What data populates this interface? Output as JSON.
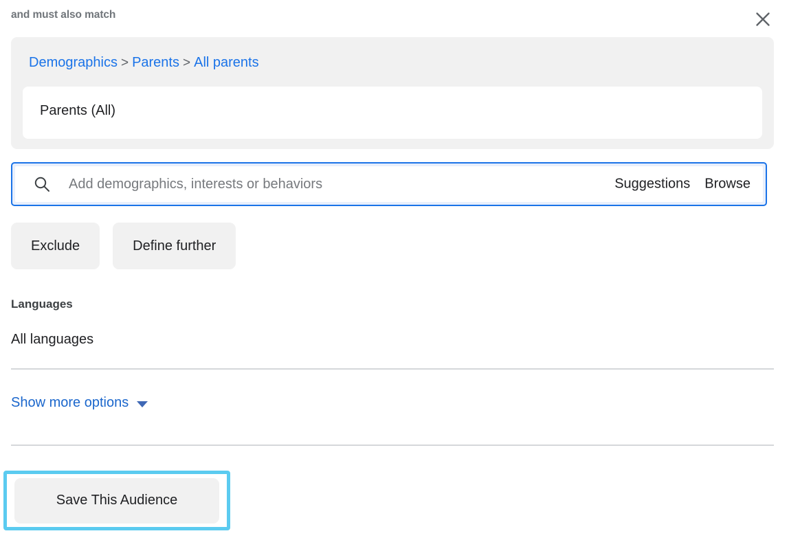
{
  "header": {
    "title": "and must also match",
    "close_icon": "close-icon"
  },
  "spec_panel": {
    "breadcrumb": {
      "items": [
        "Demographics",
        "Parents",
        "All parents"
      ],
      "separator": ">"
    },
    "selection": {
      "label": "Parents (All)"
    }
  },
  "search": {
    "icon": "search-icon",
    "placeholder": "Add demographics, interests or behaviors",
    "value": "",
    "suggestions_label": "Suggestions",
    "browse_label": "Browse"
  },
  "chips": {
    "exclude_label": "Exclude",
    "define_further_label": "Define further"
  },
  "languages": {
    "heading": "Languages",
    "value": "All languages"
  },
  "show_more": {
    "label": "Show more options",
    "icon": "chevron-down-icon"
  },
  "footer": {
    "save_audience_label": "Save This Audience"
  },
  "colors": {
    "link_blue": "#1a73e8",
    "highlight_cyan": "#5bcbf0",
    "panel_gray": "#f1f1f1",
    "text_dark": "#202124",
    "text_muted": "#70757a",
    "divider_gray": "#d5d7da"
  }
}
